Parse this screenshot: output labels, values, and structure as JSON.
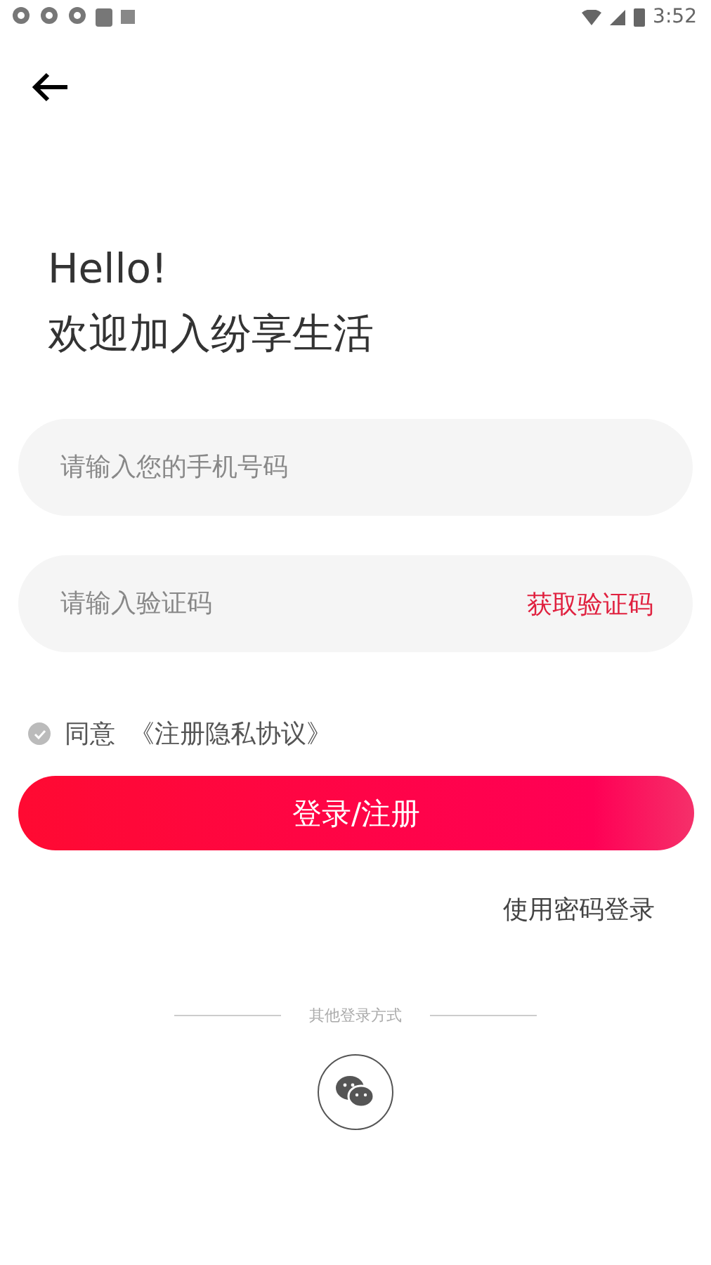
{
  "status_bar": {
    "time": "3:52"
  },
  "greeting": {
    "line_1": "Hello!",
    "line_2": "欢迎加入纷享生活"
  },
  "phone_field": {
    "placeholder": "请输入您的手机号码"
  },
  "code_field": {
    "placeholder": "请输入验证码",
    "action": "获取验证码"
  },
  "agreement": {
    "checked": true,
    "label": "同意",
    "link": "《注册隐私协议》"
  },
  "submit_button": "登录/注册",
  "password_login_link": "使用密码登录",
  "other_login": {
    "label": "其他登录方式"
  }
}
